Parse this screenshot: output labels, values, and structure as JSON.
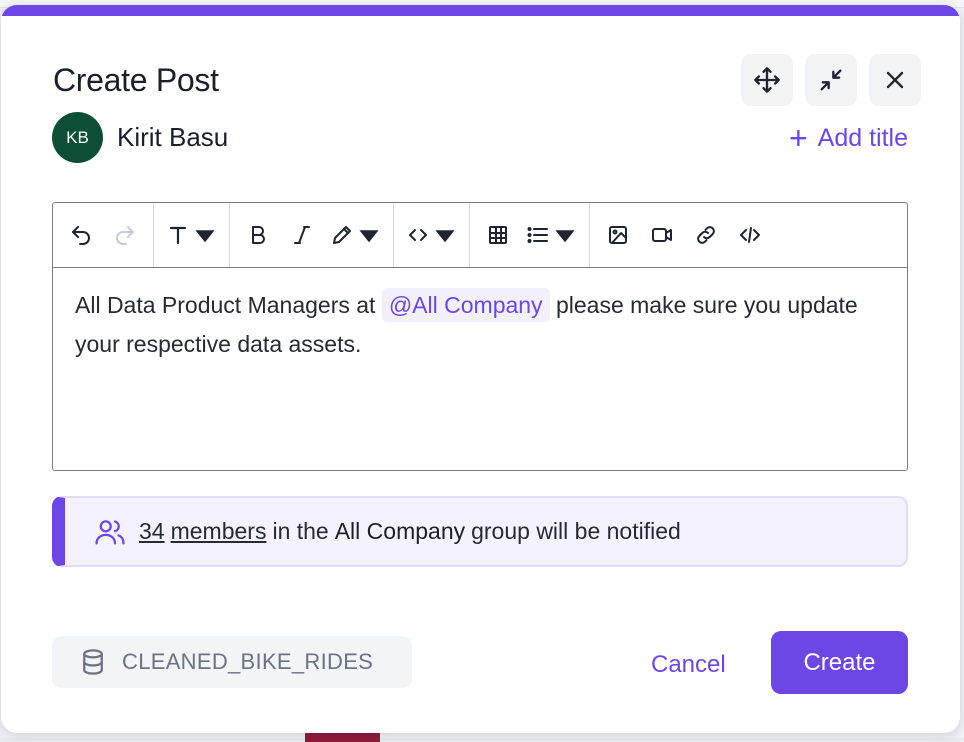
{
  "colors": {
    "accent": "#6c47e6",
    "avatar_bg": "#0c4f36",
    "notice_bg": "#f4f2fe"
  },
  "modal": {
    "title": "Create Post",
    "window_buttons": [
      {
        "name": "move-icon"
      },
      {
        "name": "collapse-icon"
      },
      {
        "name": "close-icon"
      }
    ]
  },
  "author": {
    "initials": "KB",
    "name": "Kirit Basu"
  },
  "add_title": {
    "label": "Add title"
  },
  "toolbar": {
    "items": [
      "undo-icon",
      "redo-icon",
      "text-style-icon",
      "bold-icon",
      "italic-icon",
      "highlight-icon",
      "code-icon",
      "table-icon",
      "list-icon",
      "image-icon",
      "video-icon",
      "link-icon",
      "code-block-icon"
    ]
  },
  "editor": {
    "text_before": "All Data Product Managers at",
    "mention": "@All Company",
    "text_after": "please make sure you update your respective data assets."
  },
  "notice": {
    "count": "34",
    "members_label": "members",
    "middle": "in the",
    "group": "All Company",
    "suffix": "group will be notified"
  },
  "footer": {
    "asset_name": "CLEANED_BIKE_RIDES",
    "cancel_label": "Cancel",
    "create_label": "Create"
  }
}
